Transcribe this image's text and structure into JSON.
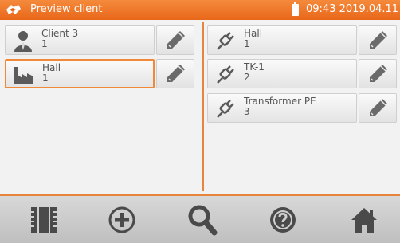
{
  "header": {
    "title": "Preview client",
    "time": "09:43 2019.04.11"
  },
  "left_list": [
    {
      "name": "Client 3",
      "number": "1",
      "icon": "person-icon"
    },
    {
      "name": "Hall",
      "number": "1",
      "icon": "factory-icon"
    }
  ],
  "right_list": [
    {
      "name": "Hall",
      "number": "1",
      "icon": "plug-icon"
    },
    {
      "name": "TK-1",
      "number": "2",
      "icon": "plug-icon"
    },
    {
      "name": "Transformer PE",
      "number": "3",
      "icon": "plug-icon"
    }
  ],
  "toolbar": [
    "memory-icon",
    "add-icon",
    "search-icon",
    "help-icon",
    "home-icon"
  ],
  "colors": {
    "accent": "#e9843f",
    "header": "#ec7127",
    "icon": "#5a5a5a"
  }
}
